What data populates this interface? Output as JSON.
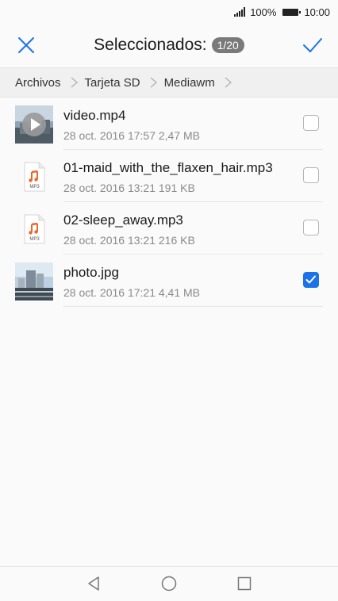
{
  "status_bar": {
    "battery_percent": "100%",
    "time": "10:00"
  },
  "header": {
    "title": "Seleccionados:",
    "selected_count": "1/20",
    "close_icon": "close-icon",
    "confirm_icon": "checkmark-icon"
  },
  "breadcrumb": {
    "items": [
      "Archivos",
      "Tarjeta SD",
      "Mediawm"
    ]
  },
  "files": [
    {
      "name": "video.mp4",
      "meta": "28 oct. 2016 17:57 2,47 MB",
      "type": "video",
      "checked": false
    },
    {
      "name": "01-maid_with_the_flaxen_hair.mp3",
      "meta": "28 oct. 2016 13:21 191 KB",
      "type": "audio",
      "checked": false
    },
    {
      "name": "02-sleep_away.mp3",
      "meta": "28 oct. 2016 13:21 216 KB",
      "type": "audio",
      "checked": false
    },
    {
      "name": "photo.jpg",
      "meta": "28 oct. 2016 17:21 4,41 MB",
      "type": "image",
      "checked": true
    }
  ],
  "file_icon_label": "MP3",
  "colors": {
    "accent": "#1a73e8",
    "audio_icon": "#e8682a"
  },
  "nav": {
    "back_icon": "back-triangle-icon",
    "home_icon": "home-circle-icon",
    "recents_icon": "recents-square-icon"
  }
}
